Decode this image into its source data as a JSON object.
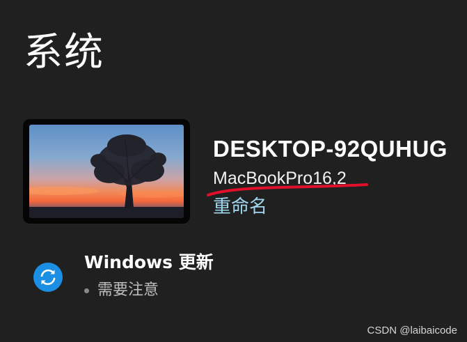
{
  "header": {
    "title": "系统"
  },
  "device": {
    "name": "DESKTOP-92QUHUG",
    "model": "MacBookPro16,2",
    "rename_label": "重命名",
    "thumbnail": "tree-sunset-wallpaper"
  },
  "windows_update": {
    "title": "Windows 更新",
    "status": "需要注意",
    "icon": "sync-icon",
    "accent_color": "#1a8fe3"
  },
  "watermark": {
    "text": "CSDN @laibaicode"
  },
  "colors": {
    "background": "#202020",
    "link": "#9fd8ef",
    "annotation_red": "#e0102a"
  }
}
